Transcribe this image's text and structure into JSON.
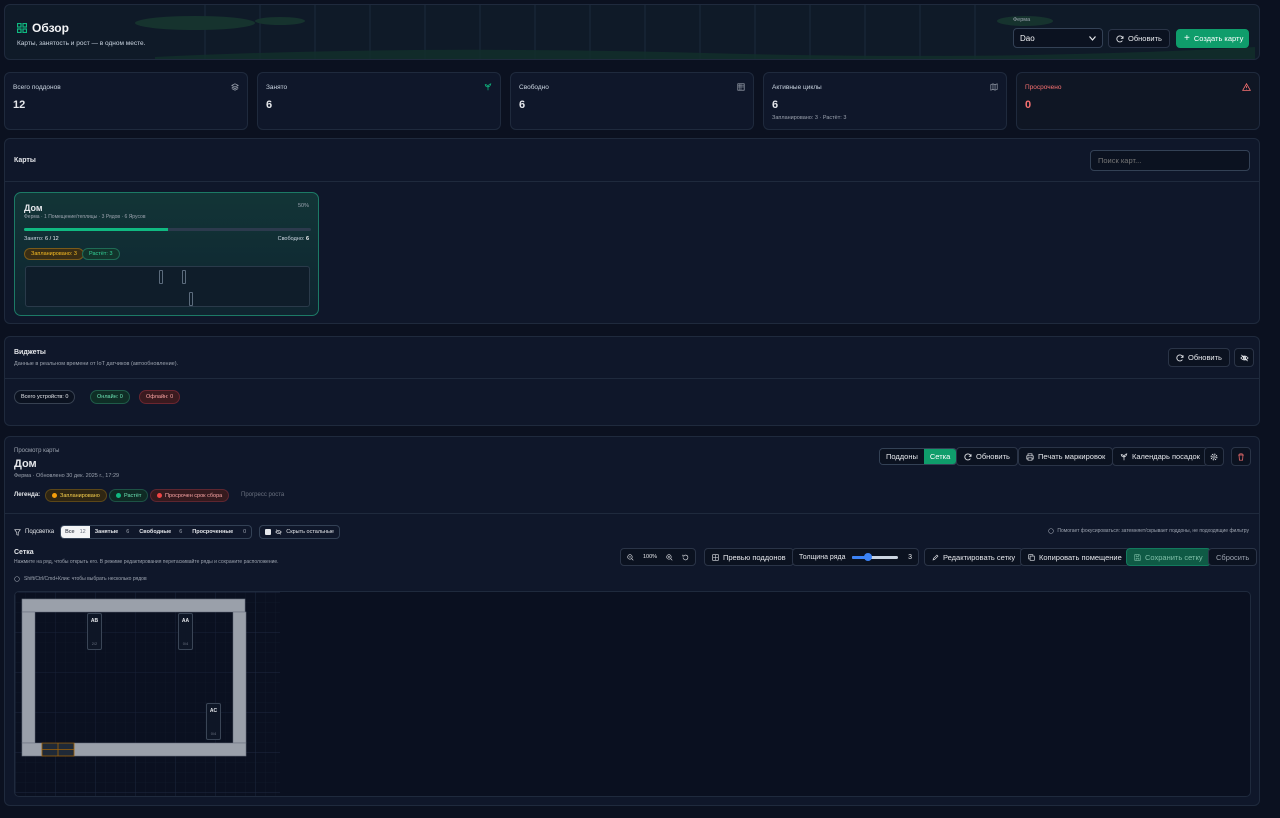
{
  "header": {
    "title": "Обзор",
    "subtitle": "Карты, занятость и рост — в одном месте.",
    "farm_label": "Ферма",
    "farm_value": "Dao",
    "refresh_label": "Обновить",
    "create_label": "Создать карту"
  },
  "stats": [
    {
      "label": "Всего поддонов",
      "value": "12",
      "sub": ""
    },
    {
      "label": "Занято",
      "value": "6",
      "sub": ""
    },
    {
      "label": "Свободно",
      "value": "6",
      "sub": ""
    },
    {
      "label": "Активные циклы",
      "value": "6",
      "sub": "Запланировано: 3 · Растёт: 3"
    },
    {
      "label": "Просрочено",
      "value": "0",
      "sub": ""
    }
  ],
  "maps": {
    "title": "Карты",
    "search_placeholder": "Поиск карт...",
    "card": {
      "name": "Дом",
      "percent": "50%",
      "meta": "Ферма · 1 Помещение/теплицы · 3 Рядов · 6 Ярусов",
      "occupied_label": "Занято:",
      "occupied_value": "6 / 12",
      "free_label": "Свободно:",
      "free_value": "6",
      "progress": 0.5,
      "badge_planned": "Запланировано: 3",
      "badge_growing": "Растёт: 3"
    }
  },
  "widgets": {
    "title": "Виджеты",
    "subtitle": "Данные в реальном времени от IoT датчиков (автообновление).",
    "refresh_label": "Обновить",
    "total_devices": "Всего устройств: 0",
    "online": "Онлайн: 0",
    "offline": "Офлайн: 0"
  },
  "preview": {
    "kicker": "Просмотр карты",
    "title": "Дом",
    "meta": "Ферма · Обновлено 30 дек. 2025 г., 17:29",
    "toggle_trays": "Поддоны",
    "toggle_grid": "Сетка",
    "refresh_label": "Обновить",
    "print_label": "Печать маркировок",
    "calendar_label": "Календарь посадок",
    "legend_label": "Легенда:",
    "legend_planned": "Запланировано",
    "legend_growing": "Растёт",
    "legend_overdue": "Просрочен срок сбора",
    "legend_progress": "Прогресс роста",
    "highlight_label": "Подсветка",
    "filters": [
      {
        "label": "Все",
        "count": "12"
      },
      {
        "label": "Занятые",
        "count": "6"
      },
      {
        "label": "Свободные",
        "count": "6"
      },
      {
        "label": "Просроченные",
        "count": "0"
      }
    ],
    "hide_others": "Скрыть остальные",
    "focus_hint": "Помогает фокусироваться: затемняет/скрывает поддоны, не подходящие фильтру",
    "grid_title": "Сетка",
    "grid_desc": "Нажмите на ряд, чтобы открыть его. В режиме редактирования перетаскивайте ряды и сохраните расположение.",
    "multi_hint": "Shift/Ctrl/Cmd+Клик: чтобы выбрать несколько рядов",
    "zoom": "100%",
    "trays_preview": "Превью поддонов",
    "row_thickness": "Толщина ряда",
    "row_thickness_value": "3",
    "row_thickness_level": 0.35,
    "edit_grid": "Редактировать сетку",
    "copy_room": "Копировать помещение",
    "save_grid": "Сохранить сетку",
    "reset": "Сбросить",
    "rows": [
      {
        "name": "AB",
        "progress": "2/2"
      },
      {
        "name": "AA",
        "progress": "0/4"
      },
      {
        "name": "AC",
        "progress": "0/4"
      }
    ]
  },
  "colors": {
    "accent": "#10b981",
    "planned": "#f59e0b",
    "growing": "#10b981",
    "overdue": "#ef4444",
    "danger": "#f87171"
  }
}
